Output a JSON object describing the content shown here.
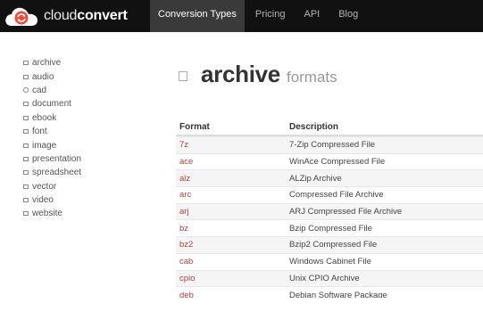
{
  "app": {
    "logo_prefix": "cloud",
    "logo_strong": "convert"
  },
  "nav": [
    {
      "label": "Conversion Types",
      "active": true
    },
    {
      "label": "Pricing",
      "active": false
    },
    {
      "label": "API",
      "active": false
    },
    {
      "label": "Blog",
      "active": false
    }
  ],
  "sidebar": {
    "items": [
      {
        "label": "archive",
        "icon": "archive-icon"
      },
      {
        "label": "audio",
        "icon": "audio-icon"
      },
      {
        "label": "cad",
        "icon": "cad-icon"
      },
      {
        "label": "document",
        "icon": "document-icon"
      },
      {
        "label": "ebook",
        "icon": "ebook-icon"
      },
      {
        "label": "font",
        "icon": "font-icon"
      },
      {
        "label": "image",
        "icon": "image-icon"
      },
      {
        "label": "presentation",
        "icon": "presentation-icon"
      },
      {
        "label": "spreadsheet",
        "icon": "spreadsheet-icon"
      },
      {
        "label": "vector",
        "icon": "vector-icon"
      },
      {
        "label": "video",
        "icon": "video-icon"
      },
      {
        "label": "website",
        "icon": "website-icon"
      }
    ]
  },
  "main": {
    "title": "archive",
    "subtitle": "formats",
    "table": {
      "headers": {
        "format": "Format",
        "description": "Description"
      },
      "rows": [
        {
          "format": "7z",
          "description": "7-Zip Compressed File"
        },
        {
          "format": "ace",
          "description": "WinAce Compressed File"
        },
        {
          "format": "alz",
          "description": "ALZip Archive"
        },
        {
          "format": "arc",
          "description": "Compressed File Archive"
        },
        {
          "format": "arj",
          "description": "ARJ Compressed File Archive"
        },
        {
          "format": "bz",
          "description": "Bzip Compressed File"
        },
        {
          "format": "bz2",
          "description": "Bzip2 Compressed File"
        },
        {
          "format": "cab",
          "description": "Windows Cabinet File"
        },
        {
          "format": "cpio",
          "description": "Unix CPIO Archive"
        },
        {
          "format": "deb",
          "description": "Debian Software Package"
        }
      ]
    }
  },
  "colors": {
    "topbar": "#111111",
    "nav_active": "#3a3a3a",
    "logo_red": "#e74c3c",
    "format_link": "#a94442"
  }
}
